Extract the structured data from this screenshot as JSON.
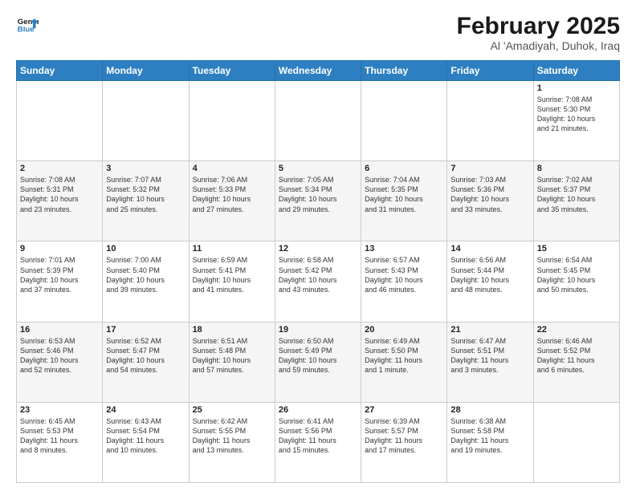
{
  "header": {
    "logo_line1": "General",
    "logo_line2": "Blue",
    "month_title": "February 2025",
    "location": "Al 'Amadiyah, Duhok, Iraq"
  },
  "days_of_week": [
    "Sunday",
    "Monday",
    "Tuesday",
    "Wednesday",
    "Thursday",
    "Friday",
    "Saturday"
  ],
  "weeks": [
    [
      {
        "day": "",
        "info": ""
      },
      {
        "day": "",
        "info": ""
      },
      {
        "day": "",
        "info": ""
      },
      {
        "day": "",
        "info": ""
      },
      {
        "day": "",
        "info": ""
      },
      {
        "day": "",
        "info": ""
      },
      {
        "day": "1",
        "info": "Sunrise: 7:08 AM\nSunset: 5:30 PM\nDaylight: 10 hours\nand 21 minutes."
      }
    ],
    [
      {
        "day": "2",
        "info": "Sunrise: 7:08 AM\nSunset: 5:31 PM\nDaylight: 10 hours\nand 23 minutes."
      },
      {
        "day": "3",
        "info": "Sunrise: 7:07 AM\nSunset: 5:32 PM\nDaylight: 10 hours\nand 25 minutes."
      },
      {
        "day": "4",
        "info": "Sunrise: 7:06 AM\nSunset: 5:33 PM\nDaylight: 10 hours\nand 27 minutes."
      },
      {
        "day": "5",
        "info": "Sunrise: 7:05 AM\nSunset: 5:34 PM\nDaylight: 10 hours\nand 29 minutes."
      },
      {
        "day": "6",
        "info": "Sunrise: 7:04 AM\nSunset: 5:35 PM\nDaylight: 10 hours\nand 31 minutes."
      },
      {
        "day": "7",
        "info": "Sunrise: 7:03 AM\nSunset: 5:36 PM\nDaylight: 10 hours\nand 33 minutes."
      },
      {
        "day": "8",
        "info": "Sunrise: 7:02 AM\nSunset: 5:37 PM\nDaylight: 10 hours\nand 35 minutes."
      }
    ],
    [
      {
        "day": "9",
        "info": "Sunrise: 7:01 AM\nSunset: 5:39 PM\nDaylight: 10 hours\nand 37 minutes."
      },
      {
        "day": "10",
        "info": "Sunrise: 7:00 AM\nSunset: 5:40 PM\nDaylight: 10 hours\nand 39 minutes."
      },
      {
        "day": "11",
        "info": "Sunrise: 6:59 AM\nSunset: 5:41 PM\nDaylight: 10 hours\nand 41 minutes."
      },
      {
        "day": "12",
        "info": "Sunrise: 6:58 AM\nSunset: 5:42 PM\nDaylight: 10 hours\nand 43 minutes."
      },
      {
        "day": "13",
        "info": "Sunrise: 6:57 AM\nSunset: 5:43 PM\nDaylight: 10 hours\nand 46 minutes."
      },
      {
        "day": "14",
        "info": "Sunrise: 6:56 AM\nSunset: 5:44 PM\nDaylight: 10 hours\nand 48 minutes."
      },
      {
        "day": "15",
        "info": "Sunrise: 6:54 AM\nSunset: 5:45 PM\nDaylight: 10 hours\nand 50 minutes."
      }
    ],
    [
      {
        "day": "16",
        "info": "Sunrise: 6:53 AM\nSunset: 5:46 PM\nDaylight: 10 hours\nand 52 minutes."
      },
      {
        "day": "17",
        "info": "Sunrise: 6:52 AM\nSunset: 5:47 PM\nDaylight: 10 hours\nand 54 minutes."
      },
      {
        "day": "18",
        "info": "Sunrise: 6:51 AM\nSunset: 5:48 PM\nDaylight: 10 hours\nand 57 minutes."
      },
      {
        "day": "19",
        "info": "Sunrise: 6:50 AM\nSunset: 5:49 PM\nDaylight: 10 hours\nand 59 minutes."
      },
      {
        "day": "20",
        "info": "Sunrise: 6:49 AM\nSunset: 5:50 PM\nDaylight: 11 hours\nand 1 minute."
      },
      {
        "day": "21",
        "info": "Sunrise: 6:47 AM\nSunset: 5:51 PM\nDaylight: 11 hours\nand 3 minutes."
      },
      {
        "day": "22",
        "info": "Sunrise: 6:46 AM\nSunset: 5:52 PM\nDaylight: 11 hours\nand 6 minutes."
      }
    ],
    [
      {
        "day": "23",
        "info": "Sunrise: 6:45 AM\nSunset: 5:53 PM\nDaylight: 11 hours\nand 8 minutes."
      },
      {
        "day": "24",
        "info": "Sunrise: 6:43 AM\nSunset: 5:54 PM\nDaylight: 11 hours\nand 10 minutes."
      },
      {
        "day": "25",
        "info": "Sunrise: 6:42 AM\nSunset: 5:55 PM\nDaylight: 11 hours\nand 13 minutes."
      },
      {
        "day": "26",
        "info": "Sunrise: 6:41 AM\nSunset: 5:56 PM\nDaylight: 11 hours\nand 15 minutes."
      },
      {
        "day": "27",
        "info": "Sunrise: 6:39 AM\nSunset: 5:57 PM\nDaylight: 11 hours\nand 17 minutes."
      },
      {
        "day": "28",
        "info": "Sunrise: 6:38 AM\nSunset: 5:58 PM\nDaylight: 11 hours\nand 19 minutes."
      },
      {
        "day": "",
        "info": ""
      }
    ]
  ]
}
